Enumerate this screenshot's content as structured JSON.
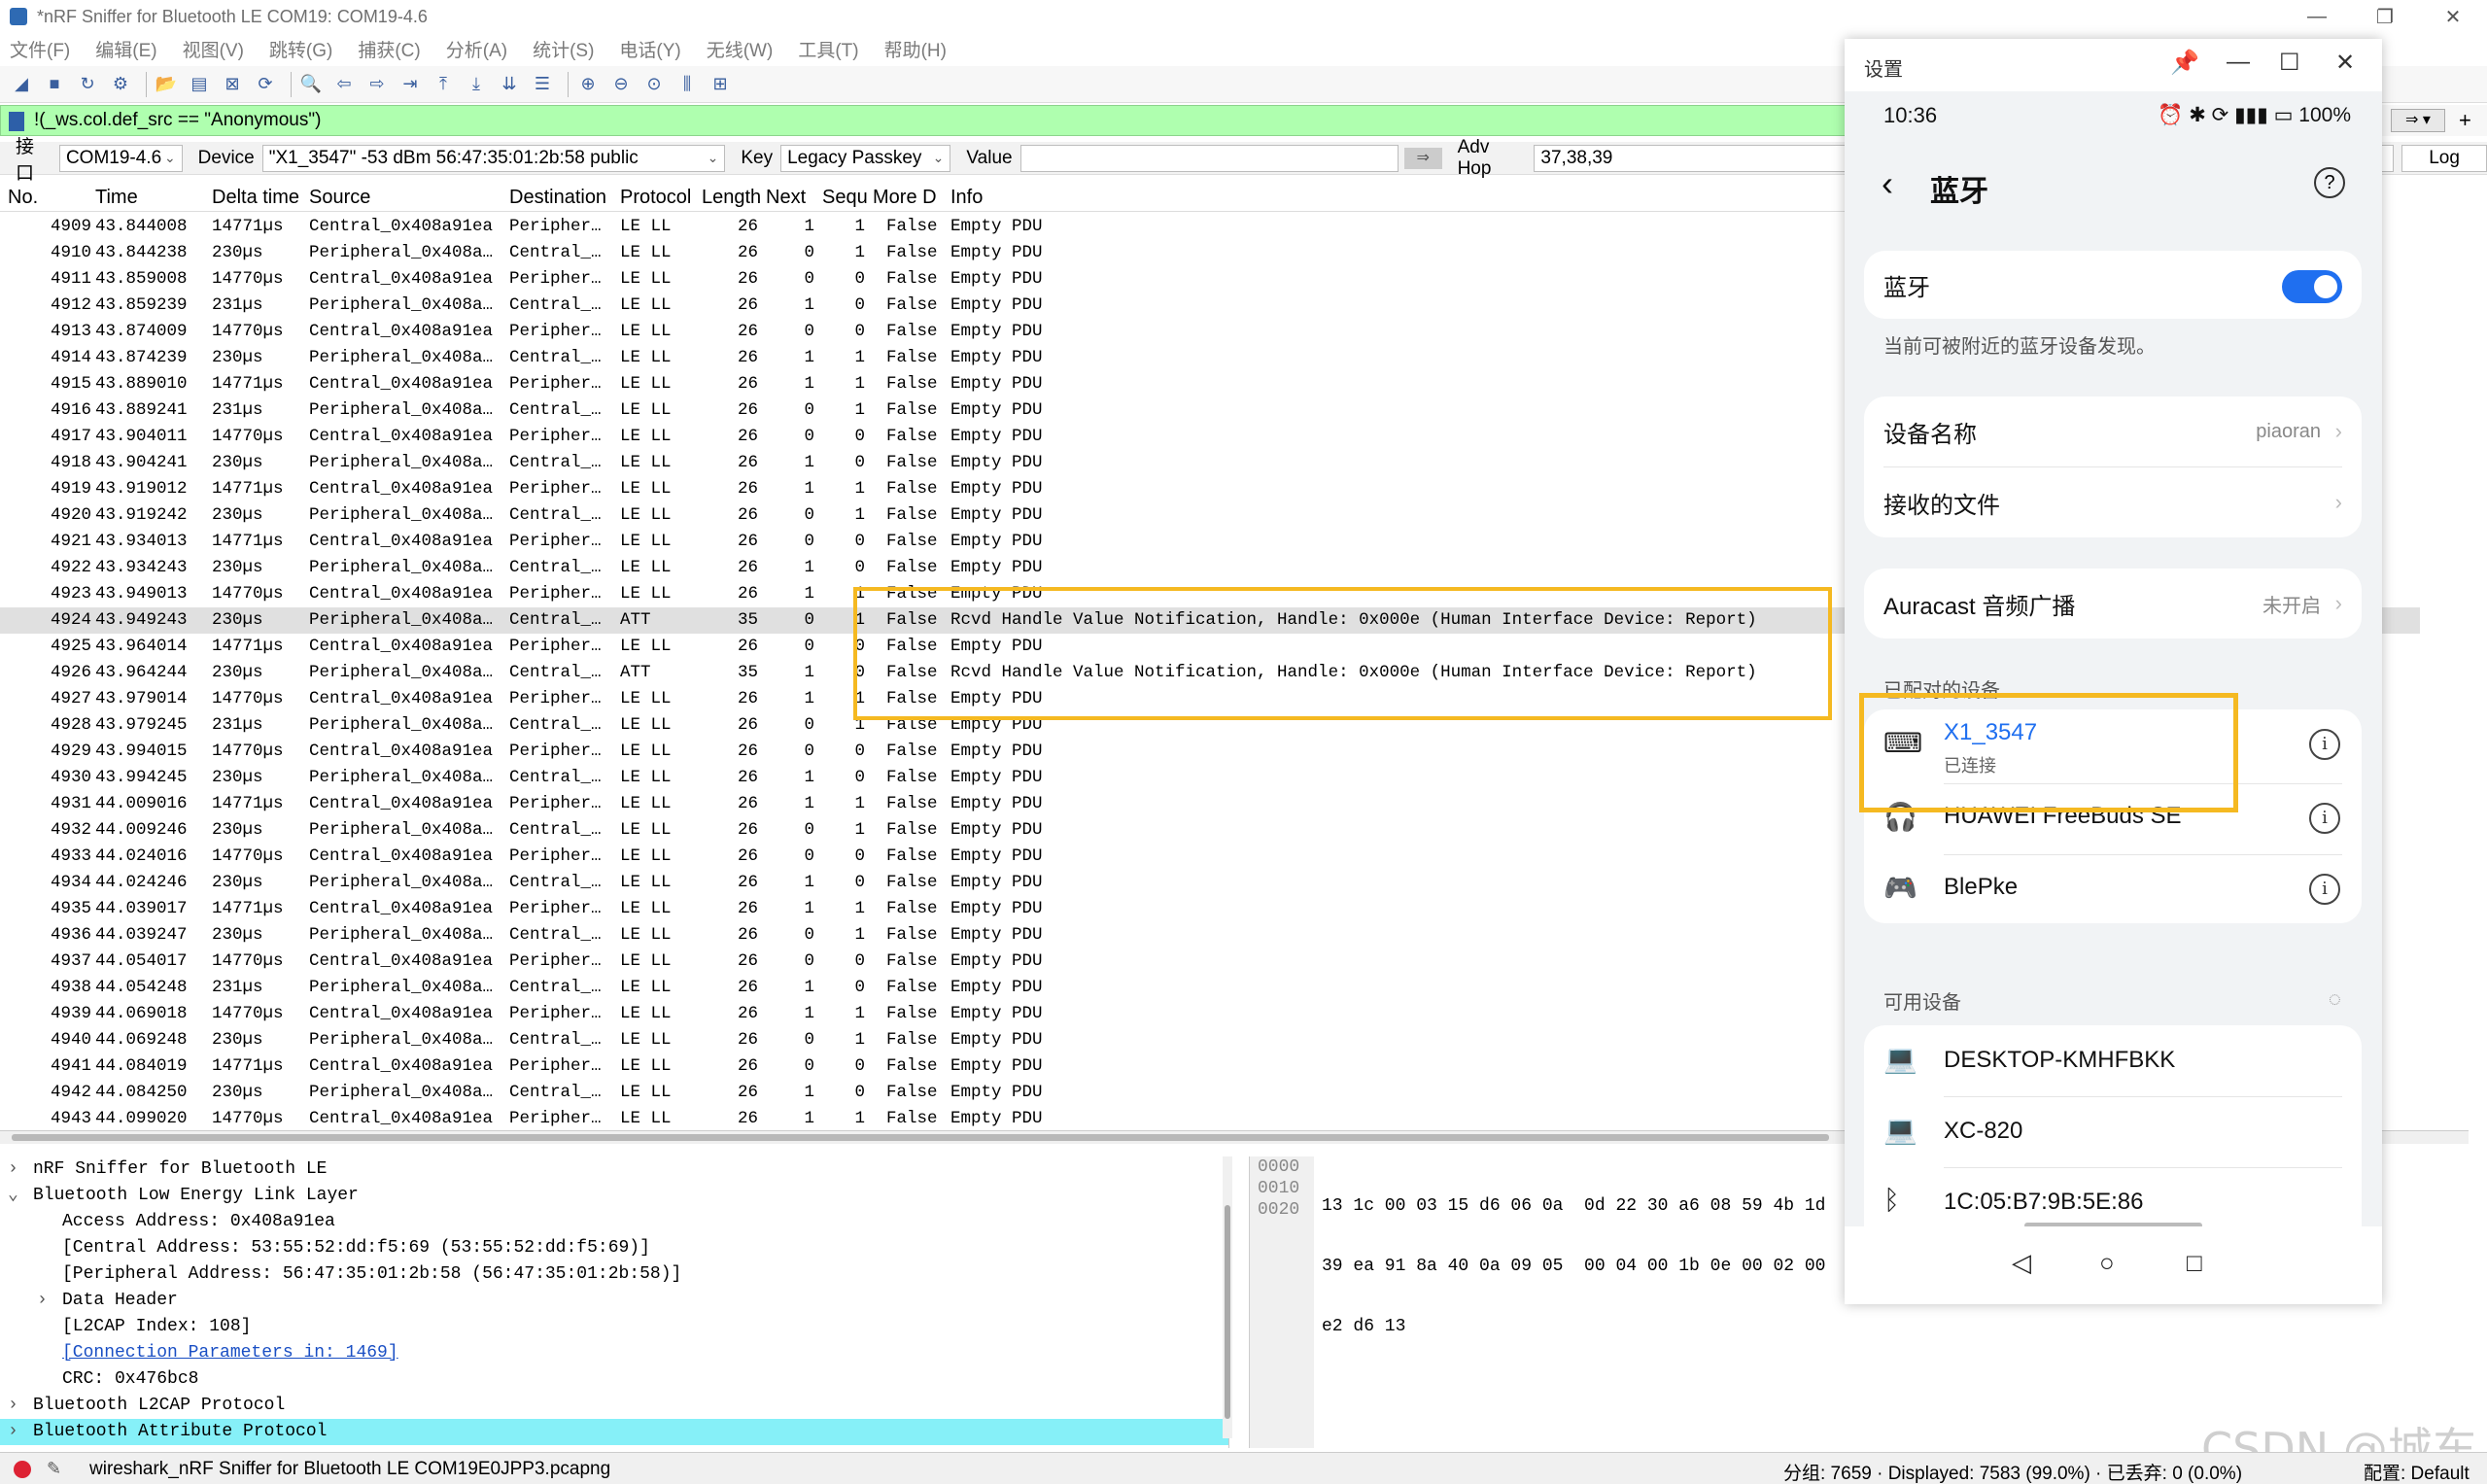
{
  "window": {
    "title": "*nRF Sniffer for Bluetooth LE COM19: COM19-4.6",
    "minimize": "—",
    "maximize": "❐",
    "close": "✕"
  },
  "menu": [
    "文件(F)",
    "编辑(E)",
    "视图(V)",
    "跳转(G)",
    "捕获(C)",
    "分析(A)",
    "统计(S)",
    "电话(Y)",
    "无线(W)",
    "工具(T)",
    "帮助(H)"
  ],
  "filter": {
    "value": "!(_ws.col.def_src == \"Anonymous\")"
  },
  "interface_bar": {
    "iface_label": "接口",
    "iface_value": "COM19-4.6",
    "device_label": "Device",
    "device_value": "\"X1_3547\"  -53 dBm  56:47:35:01:2b:58  public",
    "key_label": "Key",
    "key_value": "Legacy Passkey",
    "value_label": "Value",
    "value_value": "",
    "advhop_label": "Adv Hop",
    "advhop_value": "37,38,39",
    "log_label": "Log"
  },
  "columns": [
    "No.",
    "Time",
    "Delta time",
    "Source",
    "Destination",
    "Protocol",
    "Length",
    "Next",
    "Sequ",
    "More D",
    "Info"
  ],
  "packets": [
    [
      "4909",
      "43.844008",
      "14771µs",
      "Central_0x408a91ea",
      "Peripher…",
      "LE LL",
      "26",
      "1",
      "1",
      "False",
      "Empty PDU"
    ],
    [
      "4910",
      "43.844238",
      "230µs",
      "Peripheral_0x408a…",
      "Central_…",
      "LE LL",
      "26",
      "0",
      "1",
      "False",
      "Empty PDU"
    ],
    [
      "4911",
      "43.859008",
      "14770µs",
      "Central_0x408a91ea",
      "Peripher…",
      "LE LL",
      "26",
      "0",
      "0",
      "False",
      "Empty PDU"
    ],
    [
      "4912",
      "43.859239",
      "231µs",
      "Peripheral_0x408a…",
      "Central_…",
      "LE LL",
      "26",
      "1",
      "0",
      "False",
      "Empty PDU"
    ],
    [
      "4913",
      "43.874009",
      "14770µs",
      "Central_0x408a91ea",
      "Peripher…",
      "LE LL",
      "26",
      "0",
      "0",
      "False",
      "Empty PDU"
    ],
    [
      "4914",
      "43.874239",
      "230µs",
      "Peripheral_0x408a…",
      "Central_…",
      "LE LL",
      "26",
      "1",
      "1",
      "False",
      "Empty PDU"
    ],
    [
      "4915",
      "43.889010",
      "14771µs",
      "Central_0x408a91ea",
      "Peripher…",
      "LE LL",
      "26",
      "1",
      "1",
      "False",
      "Empty PDU"
    ],
    [
      "4916",
      "43.889241",
      "231µs",
      "Peripheral_0x408a…",
      "Central_…",
      "LE LL",
      "26",
      "0",
      "1",
      "False",
      "Empty PDU"
    ],
    [
      "4917",
      "43.904011",
      "14770µs",
      "Central_0x408a91ea",
      "Peripher…",
      "LE LL",
      "26",
      "0",
      "0",
      "False",
      "Empty PDU"
    ],
    [
      "4918",
      "43.904241",
      "230µs",
      "Peripheral_0x408a…",
      "Central_…",
      "LE LL",
      "26",
      "1",
      "0",
      "False",
      "Empty PDU"
    ],
    [
      "4919",
      "43.919012",
      "14771µs",
      "Central_0x408a91ea",
      "Peripher…",
      "LE LL",
      "26",
      "1",
      "1",
      "False",
      "Empty PDU"
    ],
    [
      "4920",
      "43.919242",
      "230µs",
      "Peripheral_0x408a…",
      "Central_…",
      "LE LL",
      "26",
      "0",
      "1",
      "False",
      "Empty PDU"
    ],
    [
      "4921",
      "43.934013",
      "14771µs",
      "Central_0x408a91ea",
      "Peripher…",
      "LE LL",
      "26",
      "0",
      "0",
      "False",
      "Empty PDU"
    ],
    [
      "4922",
      "43.934243",
      "230µs",
      "Peripheral_0x408a…",
      "Central_…",
      "LE LL",
      "26",
      "1",
      "0",
      "False",
      "Empty PDU"
    ],
    [
      "4923",
      "43.949013",
      "14770µs",
      "Central_0x408a91ea",
      "Peripher…",
      "LE LL",
      "26",
      "1",
      "1",
      "False",
      "Empty PDU"
    ],
    [
      "4924",
      "43.949243",
      "230µs",
      "Peripheral_0x408a…",
      "Central_…",
      "ATT",
      "35",
      "0",
      "1",
      "False",
      "Rcvd Handle Value Notification, Handle: 0x000e (Human Interface Device: Report)"
    ],
    [
      "4925",
      "43.964014",
      "14771µs",
      "Central_0x408a91ea",
      "Peripher…",
      "LE LL",
      "26",
      "0",
      "0",
      "False",
      "Empty PDU"
    ],
    [
      "4926",
      "43.964244",
      "230µs",
      "Peripheral_0x408a…",
      "Central_…",
      "ATT",
      "35",
      "1",
      "0",
      "False",
      "Rcvd Handle Value Notification, Handle: 0x000e (Human Interface Device: Report)"
    ],
    [
      "4927",
      "43.979014",
      "14770µs",
      "Central_0x408a91ea",
      "Peripher…",
      "LE LL",
      "26",
      "1",
      "1",
      "False",
      "Empty PDU"
    ],
    [
      "4928",
      "43.979245",
      "231µs",
      "Peripheral_0x408a…",
      "Central_…",
      "LE LL",
      "26",
      "0",
      "1",
      "False",
      "Empty PDU"
    ],
    [
      "4929",
      "43.994015",
      "14770µs",
      "Central_0x408a91ea",
      "Peripher…",
      "LE LL",
      "26",
      "0",
      "0",
      "False",
      "Empty PDU"
    ],
    [
      "4930",
      "43.994245",
      "230µs",
      "Peripheral_0x408a…",
      "Central_…",
      "LE LL",
      "26",
      "1",
      "0",
      "False",
      "Empty PDU"
    ],
    [
      "4931",
      "44.009016",
      "14771µs",
      "Central_0x408a91ea",
      "Peripher…",
      "LE LL",
      "26",
      "1",
      "1",
      "False",
      "Empty PDU"
    ],
    [
      "4932",
      "44.009246",
      "230µs",
      "Peripheral_0x408a…",
      "Central_…",
      "LE LL",
      "26",
      "0",
      "1",
      "False",
      "Empty PDU"
    ],
    [
      "4933",
      "44.024016",
      "14770µs",
      "Central_0x408a91ea",
      "Peripher…",
      "LE LL",
      "26",
      "0",
      "0",
      "False",
      "Empty PDU"
    ],
    [
      "4934",
      "44.024246",
      "230µs",
      "Peripheral_0x408a…",
      "Central_…",
      "LE LL",
      "26",
      "1",
      "0",
      "False",
      "Empty PDU"
    ],
    [
      "4935",
      "44.039017",
      "14771µs",
      "Central_0x408a91ea",
      "Peripher…",
      "LE LL",
      "26",
      "1",
      "1",
      "False",
      "Empty PDU"
    ],
    [
      "4936",
      "44.039247",
      "230µs",
      "Peripheral_0x408a…",
      "Central_…",
      "LE LL",
      "26",
      "0",
      "1",
      "False",
      "Empty PDU"
    ],
    [
      "4937",
      "44.054017",
      "14770µs",
      "Central_0x408a91ea",
      "Peripher…",
      "LE LL",
      "26",
      "0",
      "0",
      "False",
      "Empty PDU"
    ],
    [
      "4938",
      "44.054248",
      "231µs",
      "Peripheral_0x408a…",
      "Central_…",
      "LE LL",
      "26",
      "1",
      "0",
      "False",
      "Empty PDU"
    ],
    [
      "4939",
      "44.069018",
      "14770µs",
      "Central_0x408a91ea",
      "Peripher…",
      "LE LL",
      "26",
      "1",
      "1",
      "False",
      "Empty PDU"
    ],
    [
      "4940",
      "44.069248",
      "230µs",
      "Peripheral_0x408a…",
      "Central_…",
      "LE LL",
      "26",
      "0",
      "1",
      "False",
      "Empty PDU"
    ],
    [
      "4941",
      "44.084019",
      "14771µs",
      "Central_0x408a91ea",
      "Peripher…",
      "LE LL",
      "26",
      "0",
      "0",
      "False",
      "Empty PDU"
    ],
    [
      "4942",
      "44.084250",
      "230µs",
      "Peripheral_0x408a…",
      "Central_…",
      "LE LL",
      "26",
      "1",
      "0",
      "False",
      "Empty PDU"
    ],
    [
      "4943",
      "44.099020",
      "14770µs",
      "Central_0x408a91ea",
      "Peripher…",
      "LE LL",
      "26",
      "1",
      "1",
      "False",
      "Empty PDU"
    ]
  ],
  "selected_packet": "4924",
  "details": [
    {
      "text": "nRF Sniffer for Bluetooth LE",
      "level": 0,
      "expander": "›"
    },
    {
      "text": "Bluetooth Low Energy Link Layer",
      "level": 0,
      "expander": "⌄"
    },
    {
      "text": "Access Address: 0x408a91ea",
      "level": 1,
      "expander": ""
    },
    {
      "text": "[Central Address: 53:55:52:dd:f5:69 (53:55:52:dd:f5:69)]",
      "level": 1,
      "expander": ""
    },
    {
      "text": "[Peripheral Address: 56:47:35:01:2b:58 (56:47:35:01:2b:58)]",
      "level": 1,
      "expander": ""
    },
    {
      "text": "Data Header",
      "level": 1,
      "expander": "›"
    },
    {
      "text": "[L2CAP Index: 108]",
      "level": 1,
      "expander": ""
    },
    {
      "text": "[Connection Parameters in: 1469]",
      "level": 1,
      "expander": "",
      "link": true
    },
    {
      "text": "CRC: 0x476bc8",
      "level": 1,
      "expander": ""
    },
    {
      "text": "Bluetooth L2CAP Protocol",
      "level": 0,
      "expander": "›"
    },
    {
      "text": "Bluetooth Attribute Protocol",
      "level": 0,
      "expander": "›",
      "selected": true
    }
  ],
  "hex": {
    "offsets": [
      "0000",
      "0010",
      "0020"
    ],
    "bytes": [
      "13 1c 00 03 15 d6 06 0a  0d 22 30 a6 08 59 4b 1d",
      "39 ea 91 8a 40 0a 09 05  00 04 00 1b 0e 00 02 00",
      "e2 d6 13"
    ]
  },
  "status": {
    "file": "wireshark_nRF Sniffer for Bluetooth LE COM19E0JPP3.pcapng",
    "counts": "分组: 7659 · Displayed: 7583 (99.0%) · 已丢弃: 0 (0.0%)",
    "profile": "配置: Default"
  },
  "phone": {
    "window_title": "设置",
    "time": "10:36",
    "status_icons": "⏰ ✱ ⟳ ▮▮▮",
    "battery": "100%",
    "page_title": "蓝牙",
    "bt_label": "蓝牙",
    "bt_on": true,
    "discoverable_note": "当前可被附近的蓝牙设备发现。",
    "device_name_label": "设备名称",
    "device_name_value": "piaoran",
    "received_files_label": "接收的文件",
    "auracast_label": "Auracast 音频广播",
    "auracast_value": "未开启",
    "paired_header": "已配对的设备",
    "paired": [
      {
        "name": "X1_3547",
        "sub": "已连接",
        "icon": "keyboard-icon",
        "glyph": "⌨",
        "active": true
      },
      {
        "name": "HUAWEI FreeBuds SE",
        "sub": "",
        "icon": "headphones-icon",
        "glyph": "🎧",
        "active": false
      },
      {
        "name": "BlePke",
        "sub": "",
        "icon": "gamepad-icon",
        "glyph": "🎮",
        "active": false
      }
    ],
    "available_header": "可用设备",
    "available": [
      {
        "name": "DESKTOP-KMHFBKK",
        "icon": "laptop-icon",
        "glyph": "💻"
      },
      {
        "name": "XC-820",
        "icon": "laptop-icon",
        "glyph": "💻"
      },
      {
        "name": "1C:05:B7:9B:5E:86",
        "icon": "bluetooth-icon",
        "glyph": "ᛒ"
      }
    ]
  },
  "watermark": "CSDN @城东",
  "colors": {
    "filter_bg": "#afffaf",
    "highlight": "#f5b921",
    "accent": "#1f6ff0",
    "detail_selected": "#86f0f8"
  }
}
